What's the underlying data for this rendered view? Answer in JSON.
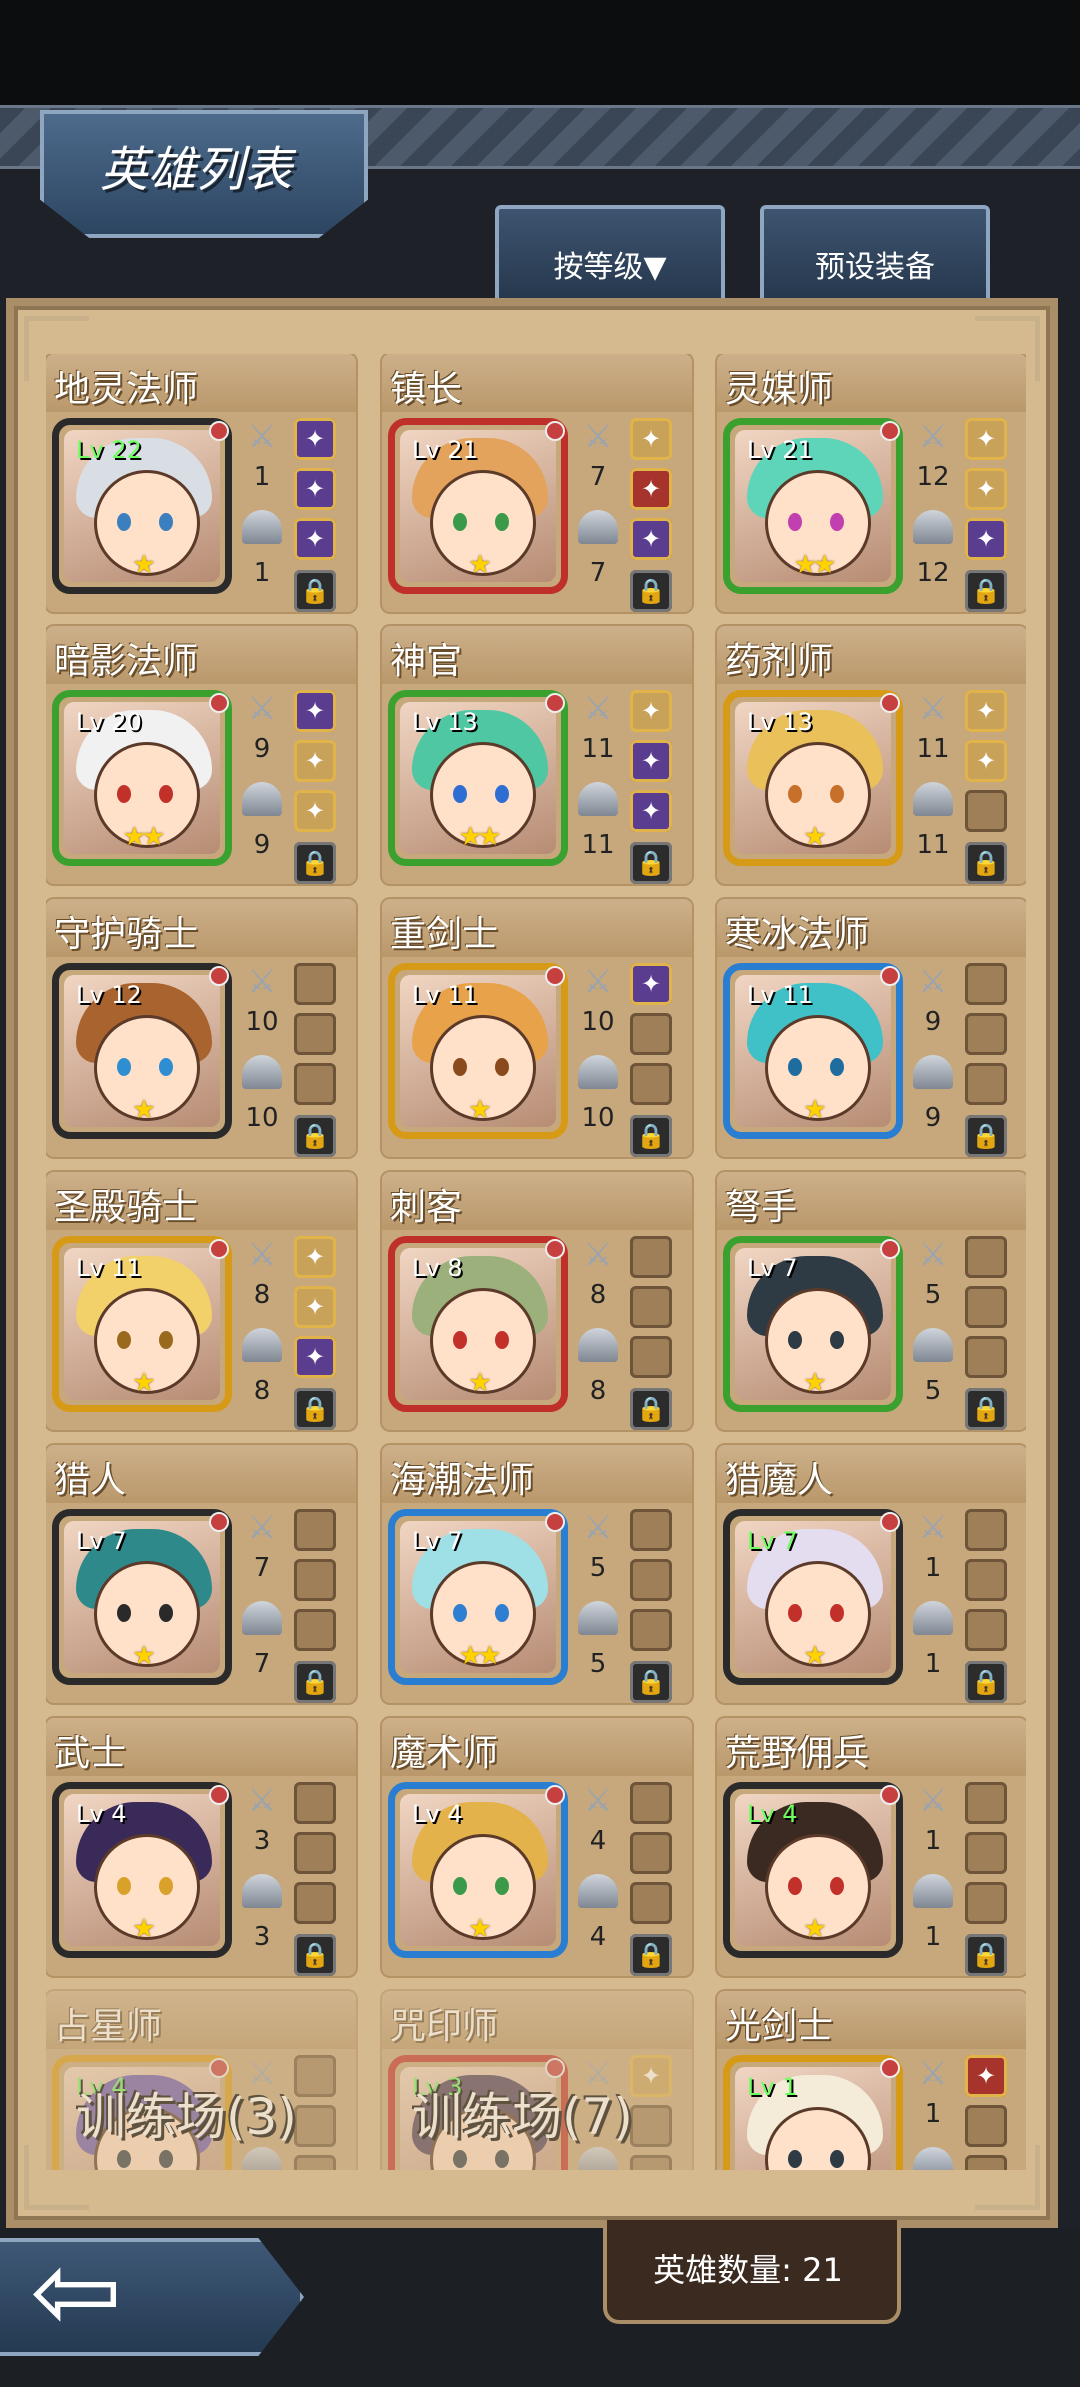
{
  "header": {
    "title": "英雄列表"
  },
  "tabs": {
    "sort": "按等级▼",
    "preset": "预设装备"
  },
  "heroes": [
    {
      "name": "地灵法师",
      "level": "Lv 22",
      "lv_green": true,
      "stars": 1,
      "weapon": "1",
      "armor": "1",
      "frame": "#2a2a2a",
      "hair": "#d9dde4",
      "eye": "#3b7fbf",
      "slots": [
        "purple",
        "purple",
        "purple"
      ],
      "training": ""
    },
    {
      "name": "镇长",
      "level": "Lv 21",
      "lv_green": false,
      "stars": 1,
      "weapon": "7",
      "armor": "7",
      "frame": "#c0302a",
      "hair": "#e3a35c",
      "eye": "#3b9a4a",
      "slots": [
        "gold",
        "red",
        "purple"
      ],
      "training": ""
    },
    {
      "name": "灵媒师",
      "level": "Lv 21",
      "lv_green": false,
      "stars": 2,
      "weapon": "12",
      "armor": "12",
      "frame": "#3aa02e",
      "hair": "#5ed4b8",
      "eye": "#c23fb0",
      "slots": [
        "gold",
        "gold",
        "purple"
      ],
      "training": ""
    },
    {
      "name": "暗影法师",
      "level": "Lv 20",
      "lv_green": false,
      "stars": 2,
      "weapon": "9",
      "armor": "9",
      "frame": "#3aa02e",
      "hair": "#f1f1f1",
      "eye": "#c2302a",
      "slots": [
        "purple",
        "gold",
        "gold"
      ],
      "training": ""
    },
    {
      "name": "神官",
      "level": "Lv 13",
      "lv_green": false,
      "stars": 2,
      "weapon": "11",
      "armor": "11",
      "frame": "#3aa02e",
      "hair": "#4fc7a2",
      "eye": "#2e6dd1",
      "slots": [
        "gold",
        "purple",
        "purple"
      ],
      "training": ""
    },
    {
      "name": "药剂师",
      "level": "Lv 13",
      "lv_green": false,
      "stars": 1,
      "weapon": "11",
      "armor": "11",
      "frame": "#d79a17",
      "hair": "#e9c05a",
      "eye": "#c8702a",
      "slots": [
        "gold",
        "gold",
        "empty"
      ],
      "training": ""
    },
    {
      "name": "守护骑士",
      "level": "Lv 12",
      "lv_green": false,
      "stars": 1,
      "weapon": "10",
      "armor": "10",
      "frame": "#2a2a2a",
      "hair": "#a9632e",
      "eye": "#2e8ed1",
      "slots": [
        "empty",
        "empty",
        "empty"
      ],
      "training": ""
    },
    {
      "name": "重剑士",
      "level": "Lv 11",
      "lv_green": false,
      "stars": 1,
      "weapon": "10",
      "armor": "10",
      "frame": "#d79a17",
      "hair": "#e8a24a",
      "eye": "#8a4a1c",
      "slots": [
        "purple",
        "empty",
        "empty"
      ],
      "training": ""
    },
    {
      "name": "寒冰法师",
      "level": "Lv 11",
      "lv_green": false,
      "stars": 1,
      "weapon": "9",
      "armor": "9",
      "frame": "#2a7ed1",
      "hair": "#3fc1c7",
      "eye": "#1f6d9e",
      "slots": [
        "empty",
        "empty",
        "empty"
      ],
      "training": ""
    },
    {
      "name": "圣殿骑士",
      "level": "Lv 11",
      "lv_green": false,
      "stars": 1,
      "weapon": "8",
      "armor": "8",
      "frame": "#d79a17",
      "hair": "#f2d06a",
      "eye": "#9a6a1c",
      "slots": [
        "gold",
        "gold",
        "purple"
      ],
      "training": ""
    },
    {
      "name": "刺客",
      "level": "Lv 8",
      "lv_green": false,
      "stars": 1,
      "weapon": "8",
      "armor": "8",
      "frame": "#c0302a",
      "hair": "#9bb07a",
      "eye": "#c2302a",
      "slots": [
        "empty",
        "empty",
        "empty"
      ],
      "training": ""
    },
    {
      "name": "弩手",
      "level": "Lv 7",
      "lv_green": false,
      "stars": 1,
      "weapon": "5",
      "armor": "5",
      "frame": "#3aa02e",
      "hair": "#2e3a44",
      "eye": "#2e3a44",
      "slots": [
        "empty",
        "empty",
        "empty"
      ],
      "training": ""
    },
    {
      "name": "猎人",
      "level": "Lv 7",
      "lv_green": false,
      "stars": 1,
      "weapon": "7",
      "armor": "7",
      "frame": "#2a2a2a",
      "hair": "#2e8a8a",
      "eye": "#2a2a2a",
      "slots": [
        "empty",
        "empty",
        "empty"
      ],
      "training": ""
    },
    {
      "name": "海潮法师",
      "level": "Lv 7",
      "lv_green": false,
      "stars": 2,
      "weapon": "5",
      "armor": "5",
      "frame": "#2a7ed1",
      "hair": "#9fe0e6",
      "eye": "#2e7ed1",
      "slots": [
        "empty",
        "empty",
        "empty"
      ],
      "training": ""
    },
    {
      "name": "猎魔人",
      "level": "Lv 7",
      "lv_green": true,
      "stars": 1,
      "weapon": "1",
      "armor": "1",
      "frame": "#2a2a2a",
      "hair": "#e4dcef",
      "eye": "#c2302a",
      "slots": [
        "empty",
        "empty",
        "empty"
      ],
      "training": ""
    },
    {
      "name": "武士",
      "level": "Lv 4",
      "lv_green": false,
      "stars": 1,
      "weapon": "3",
      "armor": "3",
      "frame": "#2a2a2a",
      "hair": "#3a2a5a",
      "eye": "#d9a12a",
      "slots": [
        "empty",
        "empty",
        "empty"
      ],
      "training": ""
    },
    {
      "name": "魔术师",
      "level": "Lv 4",
      "lv_green": false,
      "stars": 1,
      "weapon": "4",
      "armor": "4",
      "frame": "#2a7ed1",
      "hair": "#e3b24a",
      "eye": "#3b9a4a",
      "slots": [
        "empty",
        "empty",
        "empty"
      ],
      "training": ""
    },
    {
      "name": "荒野佣兵",
      "level": "Lv 4",
      "lv_green": true,
      "stars": 1,
      "weapon": "1",
      "armor": "1",
      "frame": "#2a2a2a",
      "hair": "#3a2a22",
      "eye": "#c2302a",
      "slots": [
        "empty",
        "empty",
        "empty"
      ],
      "training": ""
    },
    {
      "name": "占星师",
      "level": "Lv 4",
      "lv_green": true,
      "stars": 1,
      "weapon": "",
      "armor": "",
      "frame": "#d79a17",
      "hair": "#6a5ab0",
      "eye": "#2e3a44",
      "slots": [
        "empty",
        "empty",
        "empty"
      ],
      "training": "训练场(3)",
      "dim": true
    },
    {
      "name": "咒印师",
      "level": "Lv 3",
      "lv_green": true,
      "stars": 1,
      "weapon": "",
      "armor": "",
      "frame": "#c0302a",
      "hair": "#4a3a5a",
      "eye": "#2e3a44",
      "slots": [
        "gold",
        "empty",
        "empty"
      ],
      "training": "训练场(7)",
      "dim": true
    },
    {
      "name": "光剑士",
      "level": "Lv 1",
      "lv_green": true,
      "stars": 1,
      "weapon": "1",
      "armor": "",
      "frame": "#d79a17",
      "hair": "#f4ecd8",
      "eye": "#2e3a44",
      "slots": [
        "red",
        "empty",
        "empty"
      ],
      "training": ""
    }
  ],
  "footer": {
    "hero_count": "英雄数量: 21"
  }
}
